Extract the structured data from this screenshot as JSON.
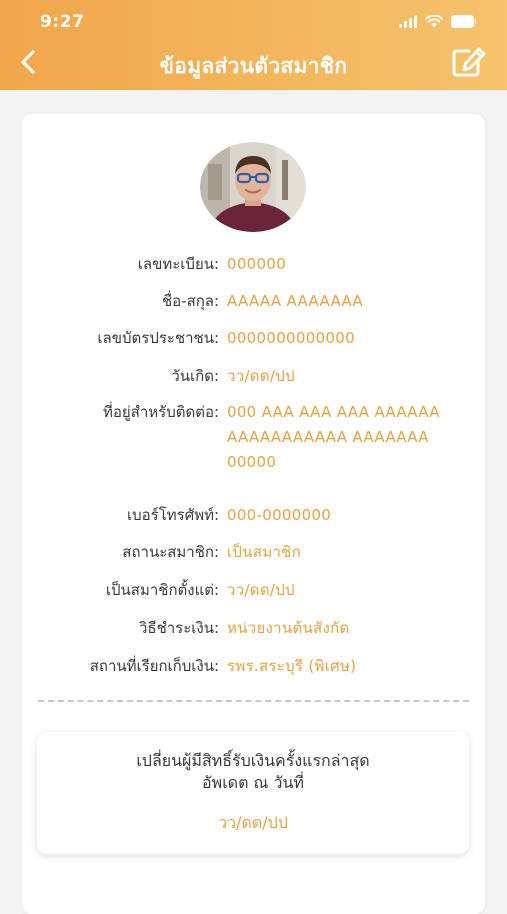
{
  "status_bar": {
    "time": "9:27"
  },
  "header": {
    "title": "ข้อมูลส่วนตัวสมาชิก",
    "back_icon": "chevron-left-icon",
    "edit_icon": "edit-icon"
  },
  "colors": {
    "header_start": "#f2a64a",
    "header_end": "#f4c36c",
    "accent": "#e8a243"
  },
  "profile": {
    "rows": [
      {
        "label": "เลขทะเบียน",
        "colon": ":",
        "value": "000000"
      },
      {
        "label": "ชื่อ-สกุล",
        "colon": ":",
        "value": "AAAAA AAAAAAA"
      },
      {
        "label": "เลขบัตรประชาชน",
        "colon": ":",
        "value": "0000000000000"
      },
      {
        "label": "วันเกิด",
        "colon": ":",
        "value": "วว/ดด/ปป"
      },
      {
        "label": "ที่อยู่สำหรับติดต่อ",
        "colon": ":",
        "value": "000 AAA AAA AAA AAAAAA AAAAAAAAAAA AAAAAAA 00000"
      },
      {
        "label": "เบอร์โทรศัพท์",
        "colon": ":",
        "value": "000-0000000"
      },
      {
        "label": "สถานะสมาชิก",
        "colon": ":",
        "value": "เป็นสมาชิก"
      },
      {
        "label": "เป็นสมาชิกตั้งแต่",
        "colon": ":",
        "value": "วว/ดด/ปป"
      },
      {
        "label": "วิธีชำระเงิน",
        "colon": ":",
        "value": "หน่วยงานต้นสังกัด"
      },
      {
        "label": "สถานที่เรียกเก็บเงิน",
        "colon": ":",
        "value": "รพร.สระบุรี (พิเศษ)"
      }
    ]
  },
  "beneficiary": {
    "title": "เปลี่ยนผู้มีสิทธิ์รับเงินครั้งแรกล่าสุด",
    "subtitle": "อัพเดต ณ วันที่",
    "date": "วว/ดด/ปป"
  }
}
